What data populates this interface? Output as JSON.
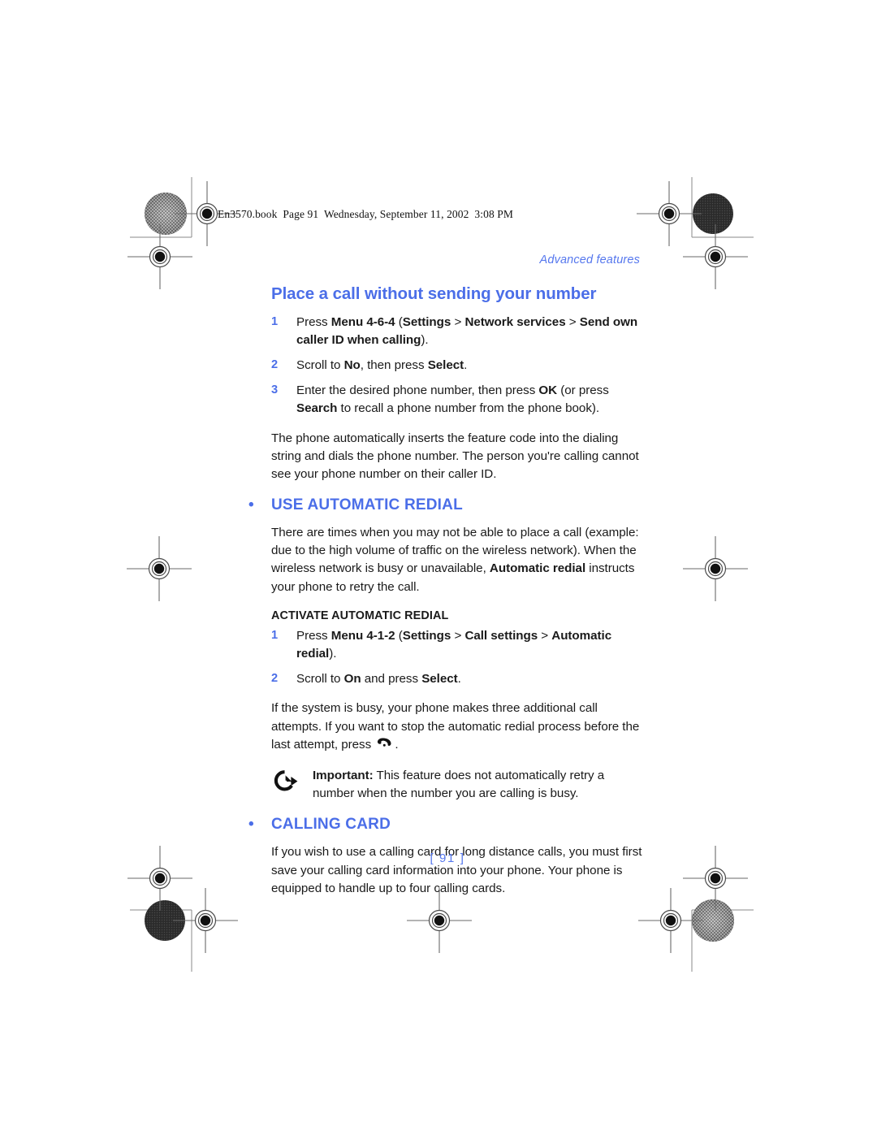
{
  "file_header": "En3570.book  Page 91  Wednesday, September 11, 2002  3:08 PM",
  "running_head": "Advanced features",
  "folio": "[ 91 ]",
  "colors": {
    "accent_blue": "#4b6ee8",
    "running_head_blue": "#5577ee",
    "body_black": "#1a1a1a"
  },
  "section1": {
    "title": "Place a call without sending your number",
    "steps": [
      {
        "num": "1",
        "parts": [
          {
            "text": "Press ",
            "bold": false
          },
          {
            "text": "Menu 4-6-4",
            "bold": true
          },
          {
            "text": " (",
            "bold": false
          },
          {
            "text": "Settings",
            "bold": true
          },
          {
            "text": " > ",
            "bold": false
          },
          {
            "text": "Network services",
            "bold": true
          },
          {
            "text": " > ",
            "bold": false
          },
          {
            "text": "Send own caller ID when calling",
            "bold": true
          },
          {
            "text": ").",
            "bold": false
          }
        ]
      },
      {
        "num": "2",
        "parts": [
          {
            "text": "Scroll to ",
            "bold": false
          },
          {
            "text": "No",
            "bold": true
          },
          {
            "text": ", then press ",
            "bold": false
          },
          {
            "text": "Select",
            "bold": true
          },
          {
            "text": ".",
            "bold": false
          }
        ]
      },
      {
        "num": "3",
        "parts": [
          {
            "text": "Enter the desired phone number, then press ",
            "bold": false
          },
          {
            "text": "OK",
            "bold": true
          },
          {
            "text": " (or press ",
            "bold": false
          },
          {
            "text": "Search",
            "bold": true
          },
          {
            "text": " to recall a phone number from the phone book).",
            "bold": false
          }
        ]
      }
    ],
    "paragraph": "The phone automatically inserts the feature code into the dialing string and dials the phone number. The person you're calling cannot see your phone number on their caller ID."
  },
  "section2": {
    "bullet": "•",
    "heading": "USE AUTOMATIC REDIAL",
    "intro_parts": [
      {
        "text": "There are times when you may not be able to place a call (example: due to the high volume of traffic on the wireless network). When the wireless network is busy or unavailable, ",
        "bold": false
      },
      {
        "text": "Automatic redial",
        "bold": true
      },
      {
        "text": " instructs your phone to retry the call.",
        "bold": false
      }
    ],
    "sub_heading": "ACTIVATE AUTOMATIC REDIAL",
    "steps": [
      {
        "num": "1",
        "parts": [
          {
            "text": "Press ",
            "bold": false
          },
          {
            "text": "Menu 4-1-2",
            "bold": true
          },
          {
            "text": " (",
            "bold": false
          },
          {
            "text": "Settings",
            "bold": true
          },
          {
            "text": " > ",
            "bold": false
          },
          {
            "text": "Call settings",
            "bold": true
          },
          {
            "text": " > ",
            "bold": false
          },
          {
            "text": "Automatic redial",
            "bold": true
          },
          {
            "text": ").",
            "bold": false
          }
        ]
      },
      {
        "num": "2",
        "parts": [
          {
            "text": "Scroll to ",
            "bold": false
          },
          {
            "text": "On",
            "bold": true
          },
          {
            "text": " and press ",
            "bold": false
          },
          {
            "text": "Select",
            "bold": true
          },
          {
            "text": ".",
            "bold": false
          }
        ]
      }
    ],
    "after_steps_parts": [
      {
        "text": "If the system is busy, your phone makes three additional call attempts. If you want to stop the automatic redial process before the last attempt, press ",
        "bold": false
      },
      {
        "icon": "end-call-handset-icon"
      },
      {
        "text": ".",
        "bold": false
      }
    ],
    "note": {
      "icon": "important-arrow-icon",
      "label": "Important:",
      "text": " This feature does not automatically retry a number when the number you are calling is busy."
    }
  },
  "section3": {
    "bullet": "•",
    "heading": "CALLING CARD",
    "paragraph": "If you wish to use a calling card for long distance calls, you must first save your calling card information into your phone. Your phone is equipped to handle up to four calling cards."
  },
  "printer_marks": {
    "registration_targets": 8,
    "starburst_patches": 2,
    "solid_density_patches": 2
  }
}
